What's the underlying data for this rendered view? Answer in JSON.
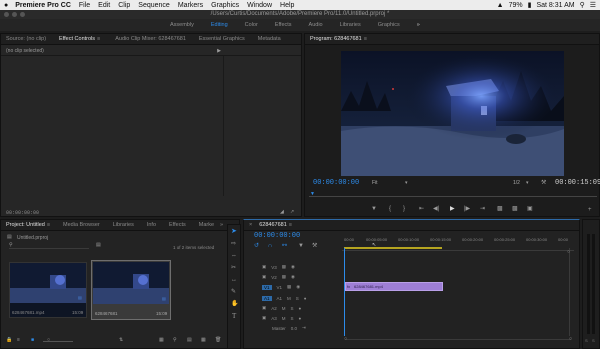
{
  "menubar": {
    "apple": "",
    "app": "Premiere Pro CC",
    "items": [
      "File",
      "Edit",
      "Clip",
      "Sequence",
      "Markers",
      "Graphics",
      "Window",
      "Help"
    ],
    "battery": "79%",
    "clock": "Sat 8:31 AM"
  },
  "titlebar": {
    "path": "/Users/Curtis/Documents/Adobe/Premiere Pro/11.0/Untitled.prproj *"
  },
  "workspaces": {
    "items": [
      "Assembly",
      "Editing",
      "Color",
      "Effects",
      "Audio",
      "Libraries",
      "Graphics"
    ],
    "active": "Editing",
    "more": "»"
  },
  "source_panel": {
    "tabs": [
      "Source: (no clip)",
      "Effect Controls",
      "Audio Clip Mixer: 628467681",
      "Essential Graphics",
      "Metadata"
    ],
    "active_tab": "Effect Controls",
    "message": "(no clip selected)",
    "timecode": "00:00:00:00"
  },
  "program_panel": {
    "title": "Program: 628467681",
    "timecode_in": "00:00:00:00",
    "fit": "Fit",
    "quality": "1/2",
    "timecode_out": "00:00:15:09"
  },
  "project_panel": {
    "tabs": [
      "Project: Untitled",
      "Media Browser",
      "Libraries",
      "Info",
      "Effects",
      "Marke"
    ],
    "active_tab": "Project: Untitled",
    "file": "Untitled.prproj",
    "items_selected": "1 of 2 items selected",
    "clips": [
      {
        "name": "628467681.mp4",
        "duration": "15:09"
      },
      {
        "name": "628467681",
        "duration": "15:09"
      }
    ]
  },
  "timeline": {
    "sequence_name": "628467681",
    "timecode": "00:00:00:00",
    "ruler": [
      "00:00",
      "00:00:05:00",
      "00:00:10:00",
      "00:00:15:00",
      "00:00:20:00",
      "00:00:25:00",
      "00:00:30:00",
      "00:00"
    ],
    "video_tracks": [
      "V3",
      "V2",
      "V1"
    ],
    "audio_tracks": [
      "A1",
      "A2",
      "A3"
    ],
    "master": "Master",
    "master_value": "0.0",
    "clip_label": "628467681.mp4"
  }
}
